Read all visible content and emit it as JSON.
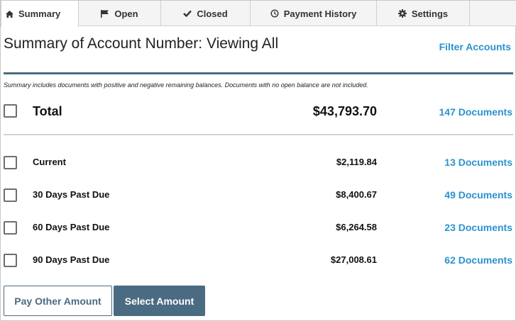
{
  "tabs": [
    {
      "label": "Summary",
      "icon": "home-icon",
      "active": true
    },
    {
      "label": "Open",
      "icon": "flag-icon",
      "active": false
    },
    {
      "label": "Closed",
      "icon": "check-icon",
      "active": false
    },
    {
      "label": "Payment History",
      "icon": "clock-icon",
      "active": false
    },
    {
      "label": "Settings",
      "icon": "gear-icon",
      "active": false
    }
  ],
  "header": {
    "title": "Summary of Account Number: Viewing All",
    "filter_link": "Filter Accounts"
  },
  "note": "Summary includes documents with positive and negative remaining balances. Documents with no open balance are not included.",
  "total": {
    "label": "Total",
    "amount": "$43,793.70",
    "documents": "147 Documents"
  },
  "aging": [
    {
      "label": "Current",
      "amount": "$2,119.84",
      "documents": "13 Documents"
    },
    {
      "label": "30 Days Past Due",
      "amount": "$8,400.67",
      "documents": "49 Documents"
    },
    {
      "label": "60 Days Past Due",
      "amount": "$6,264.58",
      "documents": "23 Documents"
    },
    {
      "label": "90 Days Past Due",
      "amount": "$27,008.61",
      "documents": "62 Documents"
    }
  ],
  "buttons": {
    "pay_other": "Pay Other Amount",
    "select_amount": "Select Amount"
  },
  "colors": {
    "accent_link": "#2a93cf",
    "primary_button": "#4b6b82"
  }
}
